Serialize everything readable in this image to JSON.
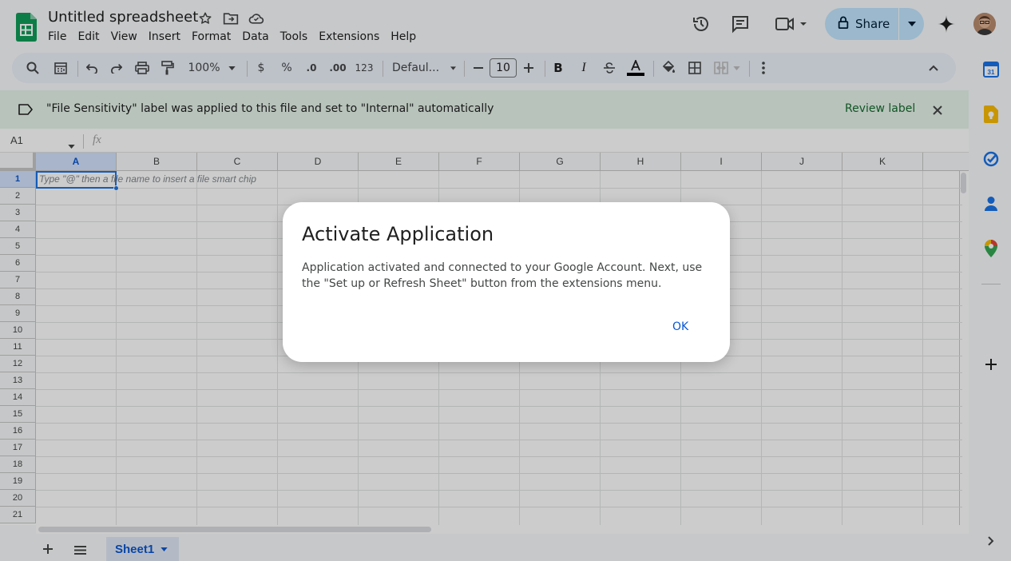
{
  "app": {
    "doc_title": "Untitled spreadsheet",
    "menu": [
      "File",
      "Edit",
      "View",
      "Insert",
      "Format",
      "Data",
      "Tools",
      "Extensions",
      "Help"
    ],
    "share_label": "Share"
  },
  "toolbar": {
    "zoom": "100%",
    "currency": "$",
    "percent": "%",
    "dec_decrease": ".0",
    "dec_increase": ".00",
    "format_123": "123",
    "font": "Defaul...",
    "font_size": "10",
    "bold": "B",
    "italic": "I"
  },
  "banner": {
    "text": "\"File Sensitivity\" label was applied to this file and set to \"Internal\" automatically",
    "action": "Review label"
  },
  "formula_bar": {
    "cell_ref": "A1",
    "fx": "fx"
  },
  "grid": {
    "columns": [
      "A",
      "B",
      "C",
      "D",
      "E",
      "F",
      "G",
      "H",
      "I",
      "J",
      "K"
    ],
    "rows": [
      "1",
      "2",
      "3",
      "4",
      "5",
      "6",
      "7",
      "8",
      "9",
      "10",
      "11",
      "12",
      "13",
      "14",
      "15",
      "16",
      "17",
      "18",
      "19",
      "20",
      "21"
    ],
    "a1_placeholder": "Type \"@\" then a file name to insert a file smart chip"
  },
  "dialog": {
    "title": "Activate Application",
    "body": "Application activated and connected to your Google Account. Next, use the \"Set up or Refresh Sheet\" button from the extensions menu.",
    "ok": "OK"
  },
  "sheets": {
    "active": "Sheet1"
  },
  "colors": {
    "accent": "#0b57d0",
    "share_bg": "#c2e7ff",
    "banner_bg": "#e6f4ea",
    "sheets_green": "#0f9d58"
  }
}
